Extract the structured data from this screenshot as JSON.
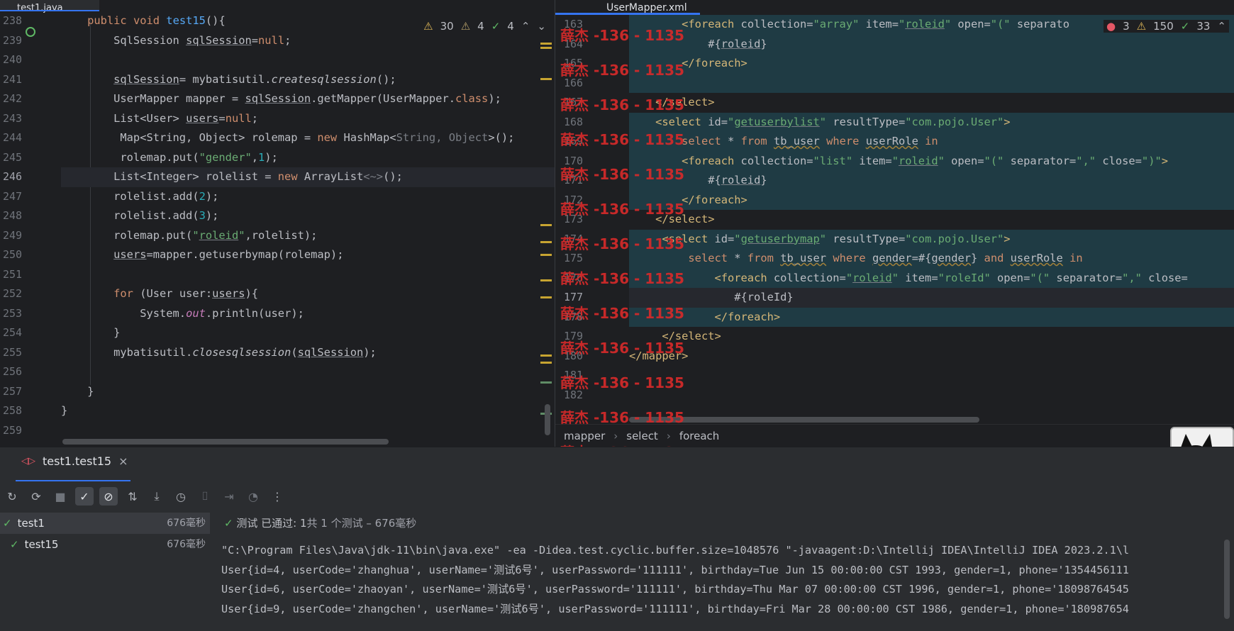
{
  "left_tab": {
    "title": "test1.java"
  },
  "right_tab": {
    "title": "UserMapper.xml"
  },
  "left_inspections": {
    "warnings_a": "30",
    "warnings_b": "4",
    "ok": "4"
  },
  "right_inspections": {
    "errors": "3",
    "warnings": "150",
    "ok": "33"
  },
  "left_lines": [
    {
      "num": "238",
      "html": "    <span class=\"kw\">public void</span> <span class=\"fn\">test15</span>(){"
    },
    {
      "num": "239",
      "html": "        SqlSession <span class=\"ul\">sqlSession</span>=<span class=\"kw\">null</span>;"
    },
    {
      "num": "240",
      "html": ""
    },
    {
      "num": "241",
      "html": "        <span class=\"ul\">sqlSession</span>= mybatisutil.<span class=\"it\">createsqlsession</span>();"
    },
    {
      "num": "242",
      "html": "        UserMapper mapper = <span class=\"ul\">sqlSession</span>.getMapper(UserMapper.<span class=\"kw\">class</span>);"
    },
    {
      "num": "243",
      "html": "        List&lt;User&gt; <span class=\"ul\">users</span>=<span class=\"kw\">null</span>;"
    },
    {
      "num": "244",
      "html": "         Map&lt;String, Object&gt; rolemap = <span class=\"kw\">new</span> HashMap&lt;<span class=\"grey\">String, Object</span>&gt;();"
    },
    {
      "num": "245",
      "html": "         rolemap.put(<span class=\"str\">\"gender\"</span>,<span class=\"num\">1</span>);"
    },
    {
      "num": "246",
      "html": "        List&lt;Integer&gt; rolelist = <span class=\"kw\">new</span> ArrayList<span class=\"grey\">&lt;~&gt;</span>();",
      "current": true
    },
    {
      "num": "247",
      "html": "        rolelist.add(<span class=\"num\">2</span>);"
    },
    {
      "num": "248",
      "html": "        rolelist.add(<span class=\"num\">3</span>);"
    },
    {
      "num": "249",
      "html": "        rolemap.put(<span class=\"str\">\"<span class=\"ul\">roleid</span>\"</span>,rolelist);"
    },
    {
      "num": "250",
      "html": "        <span class=\"ul\">users</span>=mapper.getuserbymap(rolemap);"
    },
    {
      "num": "251",
      "html": ""
    },
    {
      "num": "252",
      "html": "        <span class=\"kw\">for</span> (User user:<span class=\"ul\">users</span>){"
    },
    {
      "num": "253",
      "html": "            System.<span class=\"stat\">out</span>.println(user);"
    },
    {
      "num": "254",
      "html": "        }"
    },
    {
      "num": "255",
      "html": "        mybatisutil.<span class=\"it\">closesqlsession</span>(<span class=\"ul\">sqlSession</span>);"
    },
    {
      "num": "256",
      "html": ""
    },
    {
      "num": "257",
      "html": "    }"
    },
    {
      "num": "258",
      "html": "}"
    },
    {
      "num": "259",
      "html": ""
    }
  ],
  "right_lines": [
    {
      "num": "163",
      "html": "        <span class=\"tag\">&lt;foreach</span> collection=<span class=\"aval\">\"array\"</span> item=<span class=\"aval\">\"<span class=\"ul\">roleid</span>\"</span> open=<span class=\"aval\">\"(\"</span> separato",
      "hl": true
    },
    {
      "num": "164",
      "html": "            #{<span class=\"ul\">roleid</span>}",
      "hl": true
    },
    {
      "num": "165",
      "html": "        <span class=\"tag\">&lt;/foreach&gt;</span>",
      "hl": true
    },
    {
      "num": "166",
      "html": "",
      "hl": true
    },
    {
      "num": "167",
      "html": "    <span class=\"tag\">&lt;/select&gt;</span>"
    },
    {
      "num": "168",
      "html": "    <span class=\"tag\">&lt;select</span> id=<span class=\"aval\">\"<span class=\"ul\">getuserbylist</span>\"</span> resultType=<span class=\"aval\">\"com.pojo.User\"</span><span class=\"tag\">&gt;</span>",
      "hl": true
    },
    {
      "num": "169",
      "html": "        <span class=\"sqlkw\">select</span> * <span class=\"sqlkw\">from</span> <span class=\"sqlwarn\">tb_user</span> <span class=\"sqlkw\">where</span> <span class=\"sqlwarn\">userRole</span> <span class=\"sqlkw\">in</span>",
      "hl": true
    },
    {
      "num": "170",
      "html": "        <span class=\"tag\">&lt;foreach</span> collection=<span class=\"aval\">\"list\"</span> item=<span class=\"aval\">\"<span class=\"ul\">roleid</span>\"</span> open=<span class=\"aval\">\"(\"</span> separator=<span class=\"aval\">\",\"</span> close=<span class=\"aval\">\")\"</span><span class=\"tag\">&gt;</span>",
      "hl": true
    },
    {
      "num": "171",
      "html": "            #{<span class=\"ul\">roleid</span>}",
      "hl": true
    },
    {
      "num": "172",
      "html": "        <span class=\"tag\">&lt;/foreach&gt;</span>",
      "hl": true
    },
    {
      "num": "173",
      "html": "    <span class=\"tag\">&lt;/select&gt;</span>"
    },
    {
      "num": "174",
      "html": "     <span class=\"tag\">&lt;select</span> id=<span class=\"aval\">\"<span class=\"ul\">getuserbymap</span>\"</span> resultType=<span class=\"aval\">\"com.pojo.User\"</span><span class=\"tag\">&gt;</span>",
      "hl": true
    },
    {
      "num": "175",
      "html": "         <span class=\"sqlkw\">select</span> * <span class=\"sqlkw\">from</span> <span class=\"sqlwarn\">tb_user</span> <span class=\"sqlkw\">where</span> <span class=\"sqlwarn\">gender</span>=#{<span class=\"sqlwarn\">gender</span>} <span class=\"sqlkw\">and</span> <span class=\"sqlwarn\">userRole</span> <span class=\"sqlkw\">in</span>",
      "hl": true
    },
    {
      "num": "176",
      "html": "             <span class=\"tag\">&lt;foreach</span> collection=<span class=\"aval\">\"<span class=\"ul\">roleid</span>\"</span> item=<span class=\"aval\">\"roleId\"</span> open=<span class=\"aval\">\"(\"</span> separator=<span class=\"aval\">\",\"</span> close=",
      "hl": true
    },
    {
      "num": "177",
      "html": "                #{roleId}",
      "current": true
    },
    {
      "num": "178",
      "html": "             <span class=\"tag\">&lt;/foreach&gt;</span>",
      "hl": true
    },
    {
      "num": "179",
      "html": "     <span class=\"tag\">&lt;/select&gt;</span>"
    },
    {
      "num": "180",
      "html": "<span class=\"tag\">&lt;/mapper&gt;</span>"
    },
    {
      "num": "181",
      "html": ""
    },
    {
      "num": "182",
      "html": ""
    }
  ],
  "breadcrumb": [
    "mapper",
    "select",
    "foreach"
  ],
  "watermark": "薛杰 -136 - 1135",
  "bottom": {
    "run_tab": "test1.test15",
    "tree": [
      {
        "label": "test1",
        "time": "676毫秒"
      },
      {
        "label": "test15",
        "time": "676毫秒"
      }
    ],
    "status_prefix": "测试 已通过: 1",
    "status_suffix": "共 1 个测试 – 676毫秒",
    "console": [
      "\"C:\\Program Files\\Java\\jdk-11\\bin\\java.exe\" -ea -Didea.test.cyclic.buffer.size=1048576 \"-javaagent:D:\\Intellij IDEA\\IntelliJ IDEA 2023.2.1\\l",
      "User{id=4, userCode='zhanghua', userName='测试6号', userPassword='111111', birthday=Tue Jun 15 00:00:00 CST 1993, gender=1, phone='1354456111",
      "User{id=6, userCode='zhaoyan', userName='测试6号', userPassword='111111', birthday=Thu Mar 07 00:00:00 CST 1996, gender=1, phone='18098764545",
      "User{id=9, userCode='zhangchen', userName='测试6号', userPassword='111111', birthday=Fri Mar 28 00:00:00 CST 1986, gender=1, phone='180987654"
    ]
  },
  "colors": {
    "accent": "#3574f0",
    "watermark": "#d62a2a",
    "highlight": "#1f3b44"
  }
}
